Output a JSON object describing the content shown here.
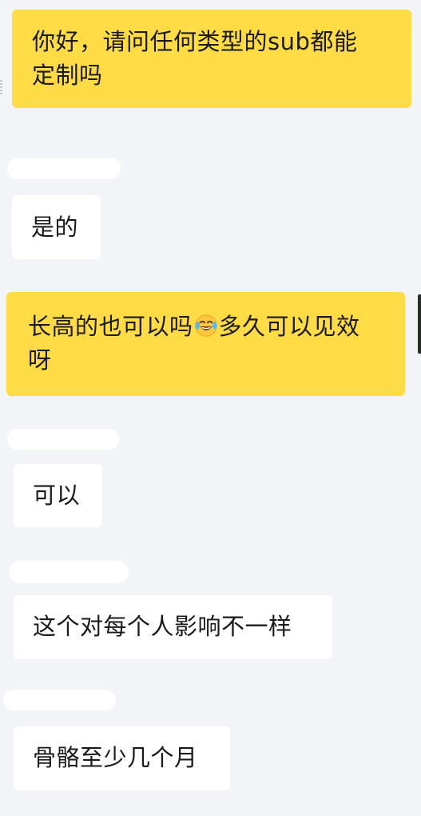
{
  "messages": [
    {
      "text_line1": "你好，请问任何类型的sub都能",
      "text_line2": "定制吗"
    },
    {
      "text": "是的"
    },
    {
      "text_line1_a": "长高的也可以吗",
      "emoji": "tears-of-joy-emoji",
      "text_line1_b": "多久可以见效",
      "text_line2": "呀"
    },
    {
      "text": "可以"
    },
    {
      "text": "这个对每个人影响不一样"
    },
    {
      "text": "骨骼至少几个月"
    }
  ],
  "colors": {
    "background": "#f3f4f8",
    "outgoing_bubble": "#ffdc45",
    "incoming_bubble": "#ffffff",
    "text": "#1a1a1a"
  }
}
